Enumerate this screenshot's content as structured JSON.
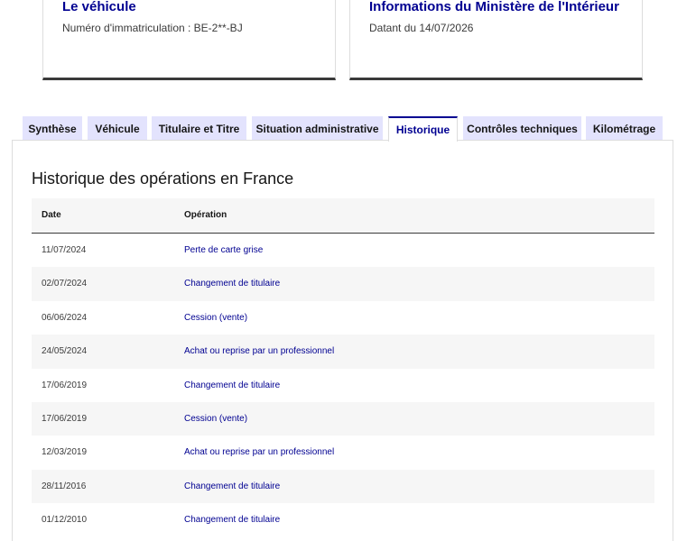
{
  "cards": {
    "vehicle": {
      "title": "Le véhicule",
      "subtitle": "Numéro d'immatriculation : BE-2**-BJ"
    },
    "ministry": {
      "title": "Informations du Ministère de l'Intérieur",
      "subtitle": "Datant du 14/07/2026"
    }
  },
  "tabs": [
    {
      "label": "Synthèse"
    },
    {
      "label": "Véhicule"
    },
    {
      "label": "Titulaire et Titre"
    },
    {
      "label": "Situation administrative"
    },
    {
      "label": "Historique",
      "active": true
    },
    {
      "label": "Contrôles techniques"
    },
    {
      "label": "Kilométrage"
    }
  ],
  "history": {
    "title": "Historique des opérations en France",
    "columns": {
      "date": "Date",
      "operation": "Opération"
    },
    "rows": [
      {
        "date": "11/07/2024",
        "operation": "Perte de carte grise"
      },
      {
        "date": "02/07/2024",
        "operation": "Changement de titulaire"
      },
      {
        "date": "06/06/2024",
        "operation": "Cession (vente)"
      },
      {
        "date": "24/05/2024",
        "operation": "Achat ou reprise par un professionnel"
      },
      {
        "date": "17/06/2019",
        "operation": "Changement de titulaire"
      },
      {
        "date": "17/06/2019",
        "operation": "Cession (vente)"
      },
      {
        "date": "12/03/2019",
        "operation": "Achat ou reprise par un professionnel"
      },
      {
        "date": "28/11/2016",
        "operation": "Changement de titulaire"
      },
      {
        "date": "01/12/2010",
        "operation": "Changement de titulaire"
      }
    ]
  },
  "colors": {
    "accent": "#000091",
    "tab_bg": "#e3e3fd",
    "row_alt": "#f6f6f6"
  }
}
